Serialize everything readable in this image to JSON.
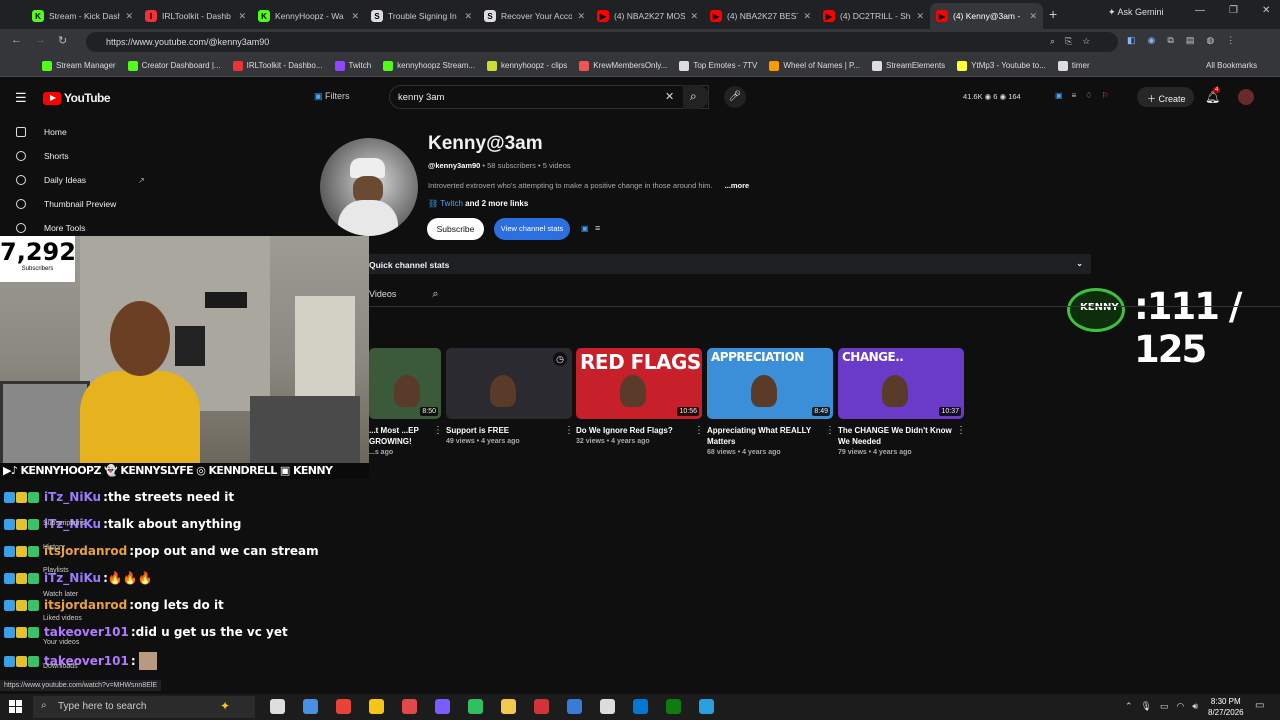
{
  "browser": {
    "tabs": [
      {
        "title": "Stream - Kick Dash",
        "color": "#53fc18",
        "letter": "K"
      },
      {
        "title": "IRLToolkit - Dashb",
        "color": "#e33",
        "letter": "I"
      },
      {
        "title": "KennyHoopz - Wa",
        "color": "#53fc18",
        "letter": "K"
      },
      {
        "title": "Trouble Signing In",
        "color": "#ddd",
        "letter": "S"
      },
      {
        "title": "Recover Your Acco",
        "color": "#ddd",
        "letter": "S"
      },
      {
        "title": "(4) NBA2K27 MOS",
        "color": "#f00",
        "letter": "▶"
      },
      {
        "title": "(4) NBA2K27 BEST",
        "color": "#f00",
        "letter": "▶"
      },
      {
        "title": "(4) DC2TRILL - She",
        "color": "#f00",
        "letter": "▶"
      },
      {
        "title": "(4) Kenny@3am -",
        "color": "#f00",
        "letter": "▶",
        "active": true
      }
    ],
    "ask_gemini": "Ask Gemini",
    "url": "https://www.youtube.com/@kenny3am90",
    "bookmarks": [
      {
        "label": "Stream Manager",
        "color": "#53fc18"
      },
      {
        "label": "Creator Dashboard |...",
        "color": "#53fc18"
      },
      {
        "label": "IRLToolkit - Dashbo...",
        "color": "#e33"
      },
      {
        "label": "Twitch",
        "color": "#9146ff"
      },
      {
        "label": "kennyhoopz Stream...",
        "color": "#53fc18"
      },
      {
        "label": "kennyhoopz - clips",
        "color": "#ccdd33"
      },
      {
        "label": "KrewMembersOnly...",
        "color": "#e55"
      },
      {
        "label": "Top Emotes - 7TV",
        "color": "#ddd"
      },
      {
        "label": "Wheel of Names | P...",
        "color": "#f90"
      },
      {
        "label": "StreamElements",
        "color": "#ddd"
      },
      {
        "label": "YtMp3 - Youtube to...",
        "color": "#ff3"
      },
      {
        "label": "timer",
        "color": "#ddd"
      }
    ],
    "all_bookmarks": "All Bookmarks"
  },
  "youtube": {
    "logo": "YouTube",
    "filters": "Filters",
    "search_value": "kenny 3am",
    "header_stats": "41.6K  ◉ 6  ◉ 164",
    "create": "Create",
    "notif_count": "4"
  },
  "sidebar": {
    "items": [
      "Home",
      "Shorts",
      "Daily Ideas",
      "Thumbnail Preview",
      "More Tools"
    ],
    "small": [
      "Subscriptions",
      "History",
      "Playlists",
      "Watch later",
      "Liked videos",
      "Your videos",
      "Downloads"
    ]
  },
  "overlay": {
    "sub_count": "7,292",
    "sub_label": "Subscribers",
    "socials": "▶♪ KENNYHOOPZ 👻 KENNYSLYFE ◎ KENNDRELL ▣ KENNY",
    "goal": ":111 / 125",
    "chat": [
      {
        "user": "iTz_NiKu",
        "color": "#9b7bff",
        "msg": "the streets need it"
      },
      {
        "user": "iTz_NiKu",
        "color": "#9b7bff",
        "msg": "talk about anything"
      },
      {
        "user": "itsjordanrod",
        "color": "#e8a040",
        "msg": "pop out and we can stream"
      },
      {
        "user": "iTz_NiKu",
        "color": "#9b7bff",
        "msg": "🔥🔥🔥"
      },
      {
        "user": "itsjordanrod",
        "color": "#e8a040",
        "msg": "ong lets do it"
      },
      {
        "user": "takeover101",
        "color": "#b07bff",
        "msg": "did u get us the vc yet"
      },
      {
        "user": "takeover101",
        "color": "#b07bff",
        "msg": ""
      }
    ]
  },
  "channel": {
    "name": "Kenny@3am",
    "handle": "@kenny3am90",
    "subscribers": "58 subscribers",
    "videos": "5 videos",
    "description": "Introverted extrovert who's attempting to make a positive change in those around him.",
    "more": "...more",
    "link_twitch": "Twitch",
    "link_more": "and 2 more links",
    "subscribe": "Subscribe",
    "view_stats": "View channel stats",
    "quick_stats": "Quick channel stats",
    "videos_tab": "Videos"
  },
  "videos": [
    {
      "title": "...t Most ...EP GROWING!",
      "meta": "...s ago",
      "dur": "8:50",
      "bg": "#3a5a3a"
    },
    {
      "title": "Support is FREE",
      "meta": "49 views • 4 years ago",
      "dur": "",
      "bg": "#2a2a30"
    },
    {
      "title": "Do We Ignore Red Flags?",
      "meta": "32 views • 4 years ago",
      "dur": "10:56",
      "bg": "#c8202a"
    },
    {
      "title": "Appreciating What REALLY Matters",
      "meta": "68 views • 4 years ago",
      "dur": "8:49",
      "bg": "#3b8fd8"
    },
    {
      "title": "The CHANGE We Didn't Know We Needed",
      "meta": "79 views • 4 years ago",
      "dur": "10:37",
      "bg": "#6a3ac8"
    }
  ],
  "thumb_text": [
    "",
    "",
    "RED FLAGS",
    "APPRECIATION",
    "CHANGE.."
  ],
  "statusbar": "https://www.youtube.com/watch?v=MHWsnn8ElE",
  "taskbar": {
    "search_placeholder": "Type here to search",
    "time": "8:30 PM",
    "date": "8/27/2026"
  }
}
